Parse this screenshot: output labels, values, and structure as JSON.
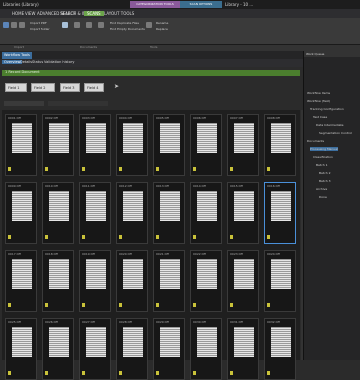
{
  "titlebar": {
    "left_label": "Libraries (Library)",
    "center_label": "Library - 10 ...",
    "context_tab_1": "CATEGORIZATION TOOLS",
    "context_tab_2": "SCAN OPTIONS"
  },
  "ribbon": {
    "tabs": [
      "HOME",
      "VIEW",
      "ADVANCED SELECT",
      "SEARCH & INDEXING",
      "LAYOUT TOOLS"
    ],
    "active_tab": "SCANS",
    "buttons": [
      "Import PDF",
      "Import folder",
      "Import Hot Folder",
      "Find Duplicate Files",
      "Find Empty Documents",
      "Rename",
      "Replace"
    ],
    "group_labels": [
      "Import",
      "Documents",
      "Tools"
    ]
  },
  "doc_tab": {
    "label": "Workflow Tools"
  },
  "subtabs": [
    "Overview",
    "Details",
    "Status",
    "Validation history"
  ],
  "active_subtab": "Overview",
  "greenbar": {
    "label": "1 Record Document"
  },
  "filters": [
    {
      "label": "Field 1"
    },
    {
      "label": "Field 2"
    },
    {
      "label": "Field 3"
    },
    {
      "label": "Field 4"
    }
  ],
  "grid_cards": [
    {
      "name": "0001.tiff"
    },
    {
      "name": "0002.tiff"
    },
    {
      "name": "0003.tiff"
    },
    {
      "name": "0004.tiff"
    },
    {
      "name": "0005.tiff"
    },
    {
      "name": "0006.tiff"
    },
    {
      "name": "0007.tiff"
    },
    {
      "name": "0008.tiff"
    },
    {
      "name": "0009.tiff"
    },
    {
      "name": "0010.tiff"
    },
    {
      "name": "0011.tiff"
    },
    {
      "name": "0012.tiff"
    },
    {
      "name": "0013.tiff"
    },
    {
      "name": "0014.tiff"
    },
    {
      "name": "0015.tiff"
    },
    {
      "name": "0016.tiff"
    },
    {
      "name": "0017.tiff"
    },
    {
      "name": "0018.tiff"
    },
    {
      "name": "0019.tiff"
    },
    {
      "name": "0020.tiff"
    },
    {
      "name": "0021.tiff"
    },
    {
      "name": "0022.tiff"
    },
    {
      "name": "0023.tiff"
    },
    {
      "name": "0024.tiff"
    },
    {
      "name": "0025.tiff"
    },
    {
      "name": "0026.tiff"
    },
    {
      "name": "0027.tiff"
    },
    {
      "name": "0028.tiff"
    },
    {
      "name": "0029.tiff"
    },
    {
      "name": "0030.tiff"
    },
    {
      "name": "0031.tiff"
    },
    {
      "name": "0032.tiff"
    }
  ],
  "right_panel": {
    "title": "Work Queue",
    "items": [
      "Workflow items",
      "Workflow (Test)",
      "Tracking Configuration",
      "Test Case",
      "Data Intermediate",
      "Segmentation Control",
      "Documents",
      "Processing Manual",
      "Classification",
      "Batch 1",
      "Batch 2",
      "Batch 3",
      "Archive",
      "Done"
    ]
  },
  "colors": {
    "accent": "#3c6e9e",
    "green": "#4b7e2e",
    "scan_tab": "#6ba34a"
  }
}
